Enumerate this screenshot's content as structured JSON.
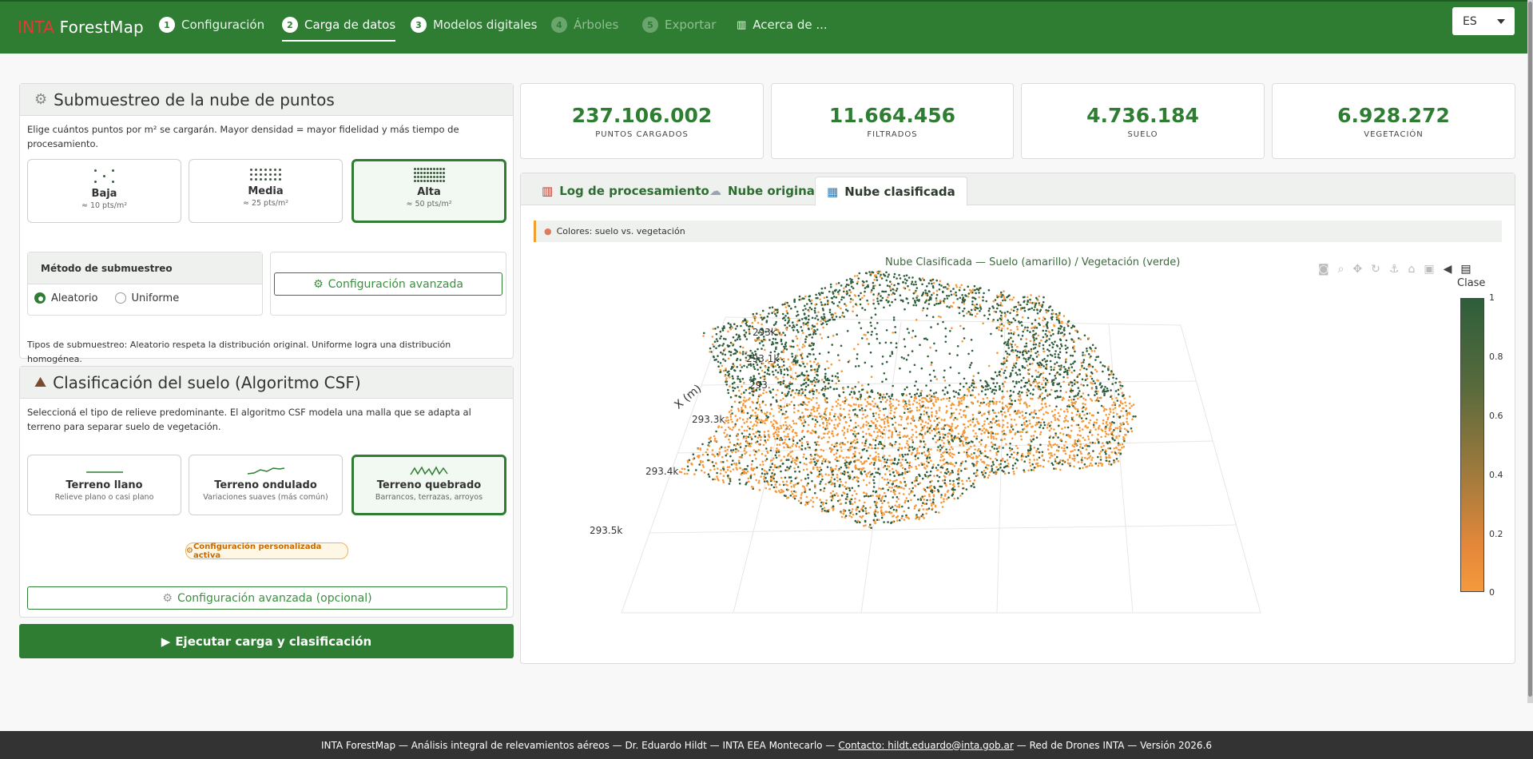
{
  "navbar": {
    "brand_red": "INTA",
    "brand_white": " ForestMap",
    "tabs": [
      {
        "num": "1",
        "label": "Configuración"
      },
      {
        "num": "2",
        "label": "Carga de datos"
      },
      {
        "num": "3",
        "label": "Modelos digitales"
      },
      {
        "num": "4",
        "label": "Árboles"
      },
      {
        "num": "5",
        "label": "Exportar"
      },
      {
        "label": "Acerca de ..."
      }
    ],
    "language": "ES"
  },
  "submuestreo": {
    "title": "Submuestreo de la nube de puntos",
    "description": "Elige cuántos puntos por m² se cargarán. Mayor densidad = mayor fidelidad y más tiempo de procesamiento.",
    "options": [
      {
        "label": "Baja",
        "sub": "≈ 10 pts/m²"
      },
      {
        "label": "Media",
        "sub": "≈ 25 pts/m²"
      },
      {
        "label": "Alta",
        "sub": "≈ 50 pts/m²"
      }
    ],
    "selected": "Alta",
    "method_title": "Método de submuestreo",
    "methods": [
      "Aleatorio",
      "Uniforme"
    ],
    "selected_method": "Aleatorio",
    "advanced_label": "Configuración avanzada",
    "note": "Tipos de submuestreo: Aleatorio respeta la distribución original. Uniforme logra una distribución homogénea."
  },
  "csf": {
    "title": "Clasificación del suelo (Algoritmo CSF)",
    "description": "Seleccioná el tipo de relieve predominante. El algoritmo CSF modela una malla que se adapta al terreno para separar suelo de vegetación.",
    "options": [
      {
        "label": "Terreno llano",
        "sub": "Relieve plano o casi plano"
      },
      {
        "label": "Terreno ondulado",
        "sub": "Variaciones suaves (más común)"
      },
      {
        "label": "Terreno quebrado",
        "sub": "Barrancos, terrazas, arroyos"
      }
    ],
    "selected": "Terreno quebrado",
    "badge": "Configuración personalizada activa",
    "advanced_label": "Configuración avanzada (opcional)"
  },
  "run_button": "Ejecutar carga y clasificación",
  "metrics": [
    {
      "value": "237.106.002",
      "label": "PUNTOS CARGADOS"
    },
    {
      "value": "11.664.456",
      "label": "FILTRADOS"
    },
    {
      "value": "4.736.184",
      "label": "SUELO"
    },
    {
      "value": "6.928.272",
      "label": "VEGETACIÓN"
    }
  ],
  "viewer": {
    "tabs": [
      "Log de procesamiento",
      "Nube original",
      "Nube clasificada"
    ],
    "active_tab": "Nube clasificada",
    "info": "Colores: suelo vs. vegetación"
  },
  "plot": {
    "title": "Nube Clasificada — Suelo (amarillo) / Vegetación (verde)",
    "axis_title": "X (m)",
    "axis_ticks": [
      "293k",
      "293.1k",
      "293.",
      "293.3k",
      "293.4k",
      "293.5k"
    ],
    "colorbar_title": "Clase",
    "colorbar_ticks": [
      "1",
      "0.8",
      "0.6",
      "0.4",
      "0.2",
      "0"
    ],
    "colors": {
      "suelo": "#f49a3c",
      "vegetacion": "#2e5e3b"
    }
  },
  "footer": {
    "pre": "INTA ForestMap — Análisis integral de relevamientos aéreos — Dr. Eduardo Hildt — INTA EEA Montecarlo —",
    "contact": "Contacto: hildt.eduardo@inta.gob.ar",
    "post": "— Red de Drones INTA — Versión 2026.6"
  },
  "icons": {
    "gear": "gear-icon",
    "mountain": "mountain-icon",
    "chart": "bar-chart-icon",
    "cloud": "cloud-icon",
    "map": "map-icon",
    "palette": "palette-icon",
    "info": "info-icon"
  }
}
